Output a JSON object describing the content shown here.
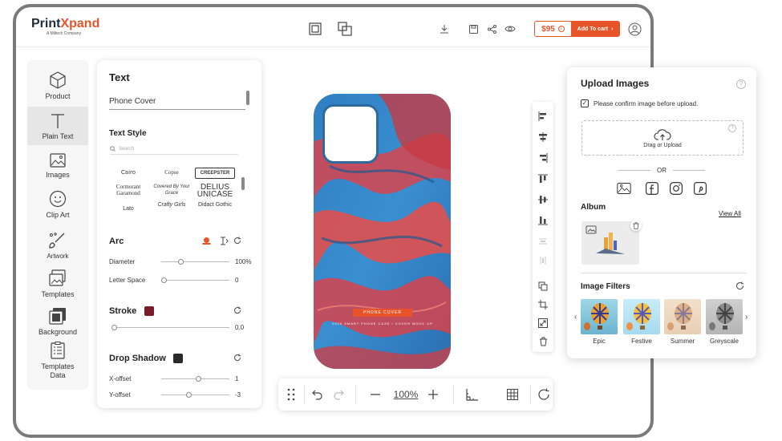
{
  "header": {
    "logo_main": "Print",
    "logo_accent": "Xpand",
    "logo_sub": "A Miltech Company",
    "price": "$95",
    "cart_label": "Add To cart",
    "accent_color": "#e8542a",
    "icons": [
      "layer-front-icon",
      "layer-back-icon",
      "download-icon",
      "save-icon",
      "share-icon",
      "preview-icon",
      "user-icon"
    ]
  },
  "sidebar": {
    "items": [
      {
        "label": "Product",
        "icon": "cube-icon"
      },
      {
        "label": "Plain Text",
        "icon": "text-icon",
        "active": true
      },
      {
        "label": "Images",
        "icon": "image-icon"
      },
      {
        "label": "Clip Art",
        "icon": "smiley-icon"
      },
      {
        "label": "Artwork",
        "icon": "brush-icon"
      },
      {
        "label": "Templates",
        "icon": "templates-icon"
      },
      {
        "label": "Background",
        "icon": "background-icon"
      },
      {
        "label": "Templates Data",
        "icon": "data-icon"
      }
    ]
  },
  "text_panel": {
    "title": "Text",
    "input_value": "Phone Cover",
    "text_style_title": "Text Style",
    "search_placeholder": "Search",
    "fonts": [
      "Cairo",
      "Copse",
      "CREEPSTER",
      "Cormorant Garamond",
      "Covered By Your Grace",
      "DELIUS UNICASE",
      "Lato",
      "Crafty Girls",
      "Didact Gothic"
    ],
    "arc_title": "Arc",
    "diameter_label": "Diameter",
    "diameter_value": "100%",
    "diameter_fraction": 0.27,
    "letter_space_label": "Letter Space",
    "letter_space_value": "0",
    "letter_space_fraction": 0.0,
    "stroke_title": "Stroke",
    "stroke_color": "#7a1c2a",
    "stroke_value": "0.0",
    "stroke_fraction": 0.0,
    "shadow_title": "Drop Shadow",
    "shadow_color": "#2a2a2a",
    "x_offset_label": "X-offset",
    "x_offset_value": "1",
    "x_offset_fraction": 0.55,
    "y_offset_label": "Y-offset",
    "y_offset_value": "-3",
    "y_offset_fraction": 0.4
  },
  "phone": {
    "tag": "PHONE COVER",
    "subtitle": "2020 SMART PHONE CASE / COVER MOCK UP"
  },
  "bottom_bar": {
    "zoom": "100%"
  },
  "upload_panel": {
    "title": "Upload Images",
    "confirm_label": "Please confirm image before upload.",
    "confirm_checked": true,
    "dropzone_label": "Drag or Upload",
    "or_label": "OR",
    "sources": [
      "gallery-icon",
      "facebook-icon",
      "instagram-icon",
      "pinterest-icon"
    ],
    "album_title": "Album",
    "view_all": "View All",
    "filters_title": "Image Filters",
    "filters": [
      "Epic",
      "Festive",
      "Summer",
      "Greyscale"
    ]
  }
}
